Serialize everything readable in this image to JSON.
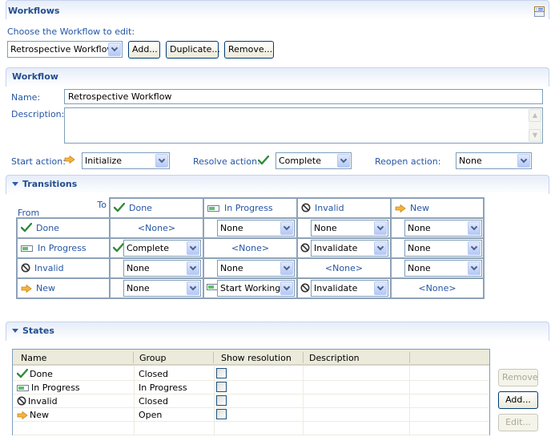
{
  "workflows": {
    "title": "Workflows",
    "choose_label": "Choose the Workflow to edit:",
    "selected_workflow": "Retrospective Workflow",
    "add_label": "Add...",
    "duplicate_label": "Duplicate...",
    "remove_label": "Remove..."
  },
  "workflow": {
    "title": "Workflow",
    "name_label": "Name:",
    "name_value": "Retrospective Workflow",
    "description_label": "Description:",
    "description_value": "",
    "start_action_label": "Start action:",
    "start_action_value": "Initialize",
    "resolve_action_label": "Resolve action:",
    "resolve_action_value": "Complete",
    "reopen_action_label": "Reopen action:",
    "reopen_action_value": "None"
  },
  "transitions": {
    "title": "Transitions",
    "to_label": "To",
    "from_label": "From",
    "columns": [
      {
        "label": "Done",
        "icon": "check-icon"
      },
      {
        "label": "In Progress",
        "icon": "progress-icon"
      },
      {
        "label": "Invalid",
        "icon": "prohibited-icon"
      },
      {
        "label": "New",
        "icon": "arrow-right-icon"
      }
    ],
    "rows": [
      {
        "label": "Done",
        "icon": "check-icon",
        "cells": [
          {
            "type": "none",
            "value": "<None>"
          },
          {
            "type": "combo",
            "value": "None",
            "icon": ""
          },
          {
            "type": "combo",
            "value": "None",
            "icon": ""
          },
          {
            "type": "combo",
            "value": "None",
            "icon": ""
          }
        ]
      },
      {
        "label": "In Progress",
        "icon": "progress-icon",
        "cells": [
          {
            "type": "combo",
            "value": "Complete",
            "icon": "check-icon"
          },
          {
            "type": "none",
            "value": "<None>"
          },
          {
            "type": "combo",
            "value": "Invalidate",
            "icon": "prohibited-icon"
          },
          {
            "type": "combo",
            "value": "None",
            "icon": ""
          }
        ]
      },
      {
        "label": "Invalid",
        "icon": "prohibited-icon",
        "cells": [
          {
            "type": "combo",
            "value": "None",
            "icon": ""
          },
          {
            "type": "combo",
            "value": "None",
            "icon": ""
          },
          {
            "type": "none",
            "value": "<None>"
          },
          {
            "type": "combo",
            "value": "None",
            "icon": ""
          }
        ]
      },
      {
        "label": "New",
        "icon": "arrow-right-icon",
        "cells": [
          {
            "type": "combo",
            "value": "None",
            "icon": ""
          },
          {
            "type": "combo",
            "value": "Start Working",
            "icon": "progress-icon"
          },
          {
            "type": "combo",
            "value": "Invalidate",
            "icon": "prohibited-icon"
          },
          {
            "type": "none",
            "value": "<None>"
          }
        ]
      }
    ]
  },
  "states": {
    "title": "States",
    "headers": [
      "Name",
      "Group",
      "Show resolution",
      "Description"
    ],
    "rows": [
      {
        "name": "Done",
        "icon": "check-icon",
        "group": "Closed",
        "show_resolution": false,
        "description": ""
      },
      {
        "name": "In Progress",
        "icon": "progress-icon",
        "group": "In Progress",
        "show_resolution": false,
        "description": ""
      },
      {
        "name": "Invalid",
        "icon": "prohibited-icon",
        "group": "Closed",
        "show_resolution": false,
        "description": ""
      },
      {
        "name": "New",
        "icon": "arrow-right-icon",
        "group": "Open",
        "show_resolution": false,
        "description": ""
      }
    ],
    "remove_label": "Remove",
    "add_label": "Add...",
    "edit_label": "Edit..."
  },
  "colors": {
    "label_blue": "#2455a5",
    "header_blue": "#244e8c",
    "check_green": "#2a8a3a",
    "arrow_orange": "#f0a020"
  }
}
